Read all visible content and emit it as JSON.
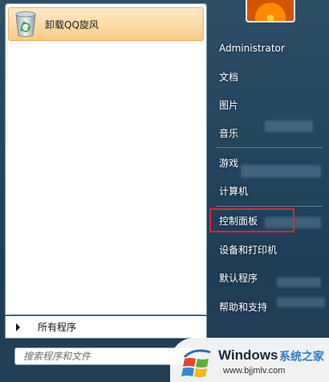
{
  "pinned_programs": [
    {
      "label": "卸载QQ旋风",
      "icon": "recycle-bin-icon"
    }
  ],
  "all_programs_label": "所有程序",
  "search": {
    "placeholder": "搜索程序和文件",
    "value": ""
  },
  "user": {
    "name": "Administrator"
  },
  "right_items": [
    {
      "label": "文档"
    },
    {
      "label": "图片"
    },
    {
      "label": "音乐"
    },
    {
      "label": "游戏"
    },
    {
      "label": "计算机"
    },
    {
      "label": "控制面板",
      "highlighted": true
    },
    {
      "label": "设备和打印机"
    },
    {
      "label": "默认程序"
    },
    {
      "label": "帮助和支持"
    }
  ],
  "watermark": {
    "brand": "Windows",
    "suffix": "系统之家",
    "url": "www.bjjmlv.com"
  },
  "colors": {
    "highlight_border": "#e3262e",
    "pinned_bg": "#fbd9a2",
    "watermark_accent": "#2e7dc4"
  }
}
